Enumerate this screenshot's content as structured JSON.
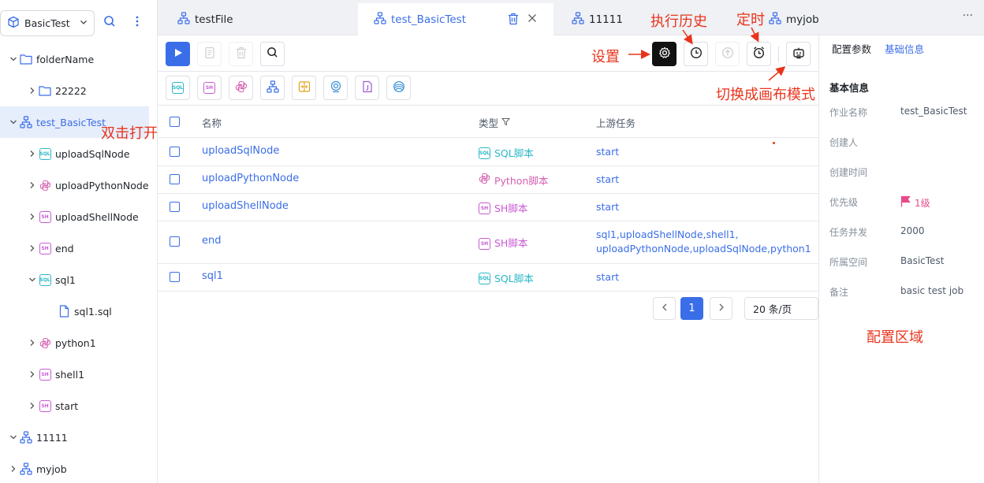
{
  "sidebar": {
    "project": "BasicTest",
    "tree": [
      {
        "label": "folderName",
        "icon": "folder-icon",
        "arrow": "down"
      },
      {
        "label": "22222",
        "icon": "folder-icon",
        "arrow": "right"
      },
      {
        "label": "test_BasicTest",
        "icon": "workflow-icon",
        "arrow": "down"
      },
      {
        "label": "uploadSqlNode",
        "icon": "sql-icon",
        "arrow": "right"
      },
      {
        "label": "uploadPythonNode",
        "icon": "python-icon",
        "arrow": "right"
      },
      {
        "label": "uploadShellNode",
        "icon": "shell-icon",
        "arrow": "right"
      },
      {
        "label": "end",
        "icon": "shell-icon",
        "arrow": "right"
      },
      {
        "label": "sql1",
        "icon": "sql-icon",
        "arrow": "down"
      },
      {
        "label": "sql1.sql",
        "icon": "file-icon",
        "arrow": ""
      },
      {
        "label": "python1",
        "icon": "python-icon",
        "arrow": "right"
      },
      {
        "label": "shell1",
        "icon": "shell-icon",
        "arrow": "right"
      },
      {
        "label": "start",
        "icon": "shell-icon",
        "arrow": "right"
      },
      {
        "label": "11111",
        "icon": "workflow-icon",
        "arrow": "down"
      },
      {
        "label": "myjob",
        "icon": "workflow-icon",
        "arrow": "right"
      }
    ]
  },
  "tabs": [
    {
      "label": "testFile"
    },
    {
      "label": "test_BasicTest"
    },
    {
      "label": "11111"
    },
    {
      "label": "myjob"
    }
  ],
  "table": {
    "headers": {
      "name": "名称",
      "type": "类型",
      "upstream": "上游任务"
    },
    "rows": [
      {
        "name": "uploadSqlNode",
        "type": "SQL脚本",
        "kind": "sql",
        "upstream": "start"
      },
      {
        "name": "uploadPythonNode",
        "type": "Python脚本",
        "kind": "python",
        "upstream": "start"
      },
      {
        "name": "uploadShellNode",
        "type": "SH脚本",
        "kind": "sh",
        "upstream": "start"
      },
      {
        "name": "end",
        "type": "SH脚本",
        "kind": "sh",
        "upstream": "sql1,uploadShellNode,shell1,\nuploadPythonNode,uploadSqlNode,python1"
      },
      {
        "name": "sql1",
        "type": "SQL脚本",
        "kind": "sql",
        "upstream": "start"
      }
    ]
  },
  "pagination": {
    "current": "1",
    "page_size": "20 条/页"
  },
  "right_panel": {
    "tabs": [
      "配置参数",
      "基础信息"
    ],
    "section": "基本信息",
    "fields": [
      {
        "key": "作业名称",
        "value": "test_BasicTest"
      },
      {
        "key": "创建人",
        "value": ""
      },
      {
        "key": "创建时间",
        "value": ""
      },
      {
        "key": "优先级",
        "value": "1级"
      },
      {
        "key": "任务并发",
        "value": "2000"
      },
      {
        "key": "所属空间",
        "value": "BasicTest"
      },
      {
        "key": "备注",
        "value": "basic test job"
      }
    ]
  },
  "annotations": {
    "double_click": "双击打开",
    "settings": "设置",
    "history": "执行历史",
    "timer": "定时",
    "canvas": "切换成画布模式",
    "config_area": "配置区域"
  },
  "colors": {
    "accent": "#3a6ee8",
    "annotation": "#e8341c",
    "sql": "#2bb8c6",
    "sh": "#c75bd4",
    "python": "#d65fb0",
    "priority": "#e84b8a"
  }
}
